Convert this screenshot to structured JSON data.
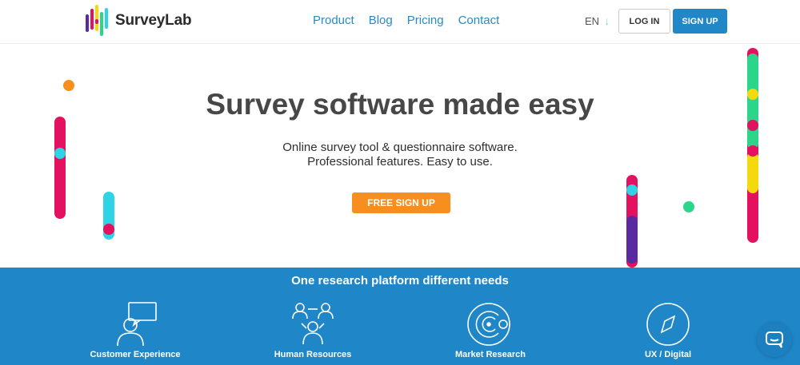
{
  "brand": {
    "name": "SurveyLab"
  },
  "nav": {
    "items": [
      {
        "label": "Product"
      },
      {
        "label": "Blog"
      },
      {
        "label": "Pricing"
      },
      {
        "label": "Contact"
      }
    ]
  },
  "header": {
    "language": "EN",
    "login_label": "LOG IN",
    "signup_label": "SIGN UP"
  },
  "hero": {
    "title": "Survey software made easy",
    "subtitle_line1": "Online survey tool & questionnaire software.",
    "subtitle_line2": "Professional features. Easy to use.",
    "cta_label": "FREE SIGN UP"
  },
  "features": {
    "title": "One research platform different needs",
    "items": [
      {
        "label": "Customer Experience",
        "icon": "customer-experience-icon"
      },
      {
        "label": "Human Resources",
        "icon": "human-resources-icon"
      },
      {
        "label": "Market Research",
        "icon": "market-research-icon"
      },
      {
        "label": "UX / Digital",
        "icon": "compass-icon"
      }
    ]
  },
  "colors": {
    "primary_blue": "#1f87c7",
    "nav_blue": "#2a8ac6",
    "orange": "#f78e1e",
    "magenta": "#e3115f",
    "cyan": "#2ed3e6",
    "green": "#2bd68a",
    "yellow": "#f5d90f",
    "purple": "#5a2aa0"
  }
}
